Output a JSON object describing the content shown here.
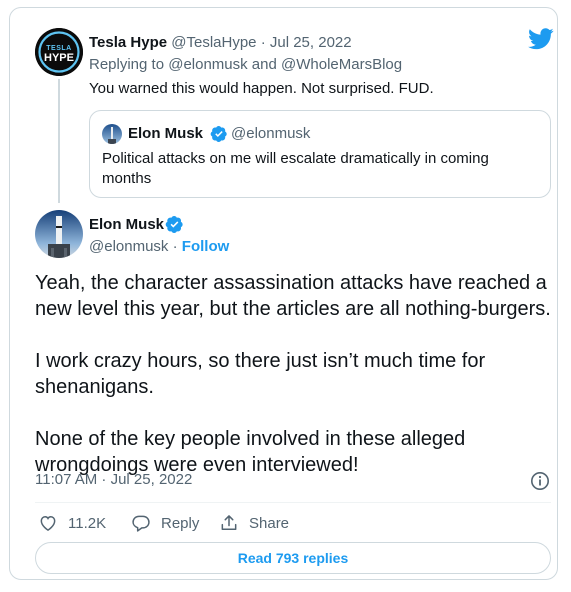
{
  "reply": {
    "display_name": "Tesla Hype",
    "handle": "@TeslaHype",
    "date": "Jul 25, 2022",
    "replying_to": "Replying to @elonmusk and @WholeMarsBlog",
    "text": "You warned this would happen. Not surprised. FUD.",
    "avatar_logo_top": "TESLA",
    "avatar_logo_bottom": "HYPE"
  },
  "quote": {
    "display_name": "Elon Musk",
    "handle": "@elonmusk",
    "text": "Political attacks on me will escalate dramatically in coming months"
  },
  "tweet": {
    "display_name": "Elon Musk",
    "handle": "@elonmusk",
    "separator": "·",
    "follow_label": "Follow",
    "paragraphs": [
      "Yeah, the character assassination attacks have reached a new level this year, but the articles are all nothing-burgers.",
      "I work crazy hours, so there just isn’t much time for shenanigans.",
      "None of the key people involved in these alleged wrongdoings were even interviewed!"
    ],
    "timestamp": "11:07 AM · Jul 25, 2022",
    "like_count": "11.2K",
    "reply_label": "Reply",
    "share_label": "Share",
    "read_replies_label": "Read 793 replies"
  },
  "colors": {
    "accent": "#1d9bf0",
    "secondary_text": "#536471",
    "border": "#cfd9de"
  },
  "icons": [
    "twitter-bird-icon",
    "verified-badge-icon",
    "info-icon",
    "heart-icon",
    "reply-bubble-icon",
    "share-icon"
  ]
}
